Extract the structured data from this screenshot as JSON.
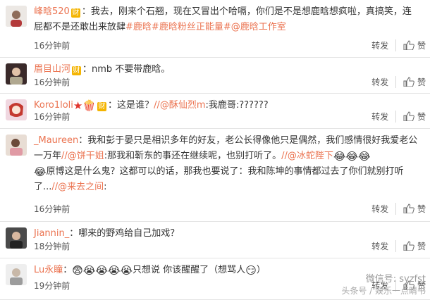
{
  "comments": [
    {
      "username": "峰晗520",
      "badge": "财",
      "text_1": "：我去，刚来个石翘，现在又冒出个哈嗝，你们是不是想鹿晗想疯啦，真搞笑，连",
      "text_2a": "屁都不是还敢出来放肆",
      "tag_1": "#鹿晗",
      "tag_2": "#鹿晗粉丝正能量",
      "tag_3": "#@鹿晗工作室",
      "time": "16分钟前",
      "repost": "转发",
      "like": "赞"
    },
    {
      "username": "眉目山河",
      "badge": "财",
      "text": "：nmb 不要带鹿晗。",
      "time": "16分钟前",
      "repost": "转发",
      "like": "赞"
    },
    {
      "username": "Koro1loli",
      "badge": "财",
      "text_a": "：这是谁？",
      "mention": "//@酥仙烈m",
      "text_b": ":我鹿哥:??????",
      "time": "16分钟前",
      "repost": "转发",
      "like": "赞"
    },
    {
      "username": "_Maureen",
      "text_1": "：我和彭于晏只是相识多年的好友，老公长得像他只是偶然，我们感情很好我爱老公",
      "text_2a": "一万年",
      "mention_1": "//@饼干姐",
      "text_2b": ":那我和靳东的事还在继续呢，也别打听了。",
      "mention_2": "//@冰蛇陛下",
      "text_3a": "原博这是什么鬼？这都可以的话，那我也要说了：我和陈坤的事情都过去了你们就别打听",
      "text_4a": "了...",
      "mention_3": "//@来去之间",
      "text_4b": ":",
      "time": "16分钟前",
      "repost": "转发",
      "like": "赞"
    },
    {
      "username": "Jiannin_",
      "text": "：哪来的野鸡给自己加戏？",
      "time": "18分钟前",
      "repost": "转发",
      "like": "赞"
    },
    {
      "username": "Lu永瞳",
      "text_a": "只想说 你该醒醒了（想骂人",
      "text_b": "）",
      "time": "19分钟前",
      "repost": "转发",
      "like": "赞"
    }
  ],
  "watermark": {
    "line_1": "微信号: syzfst",
    "line_2": "头条号 / 娱乐一点睛书"
  }
}
